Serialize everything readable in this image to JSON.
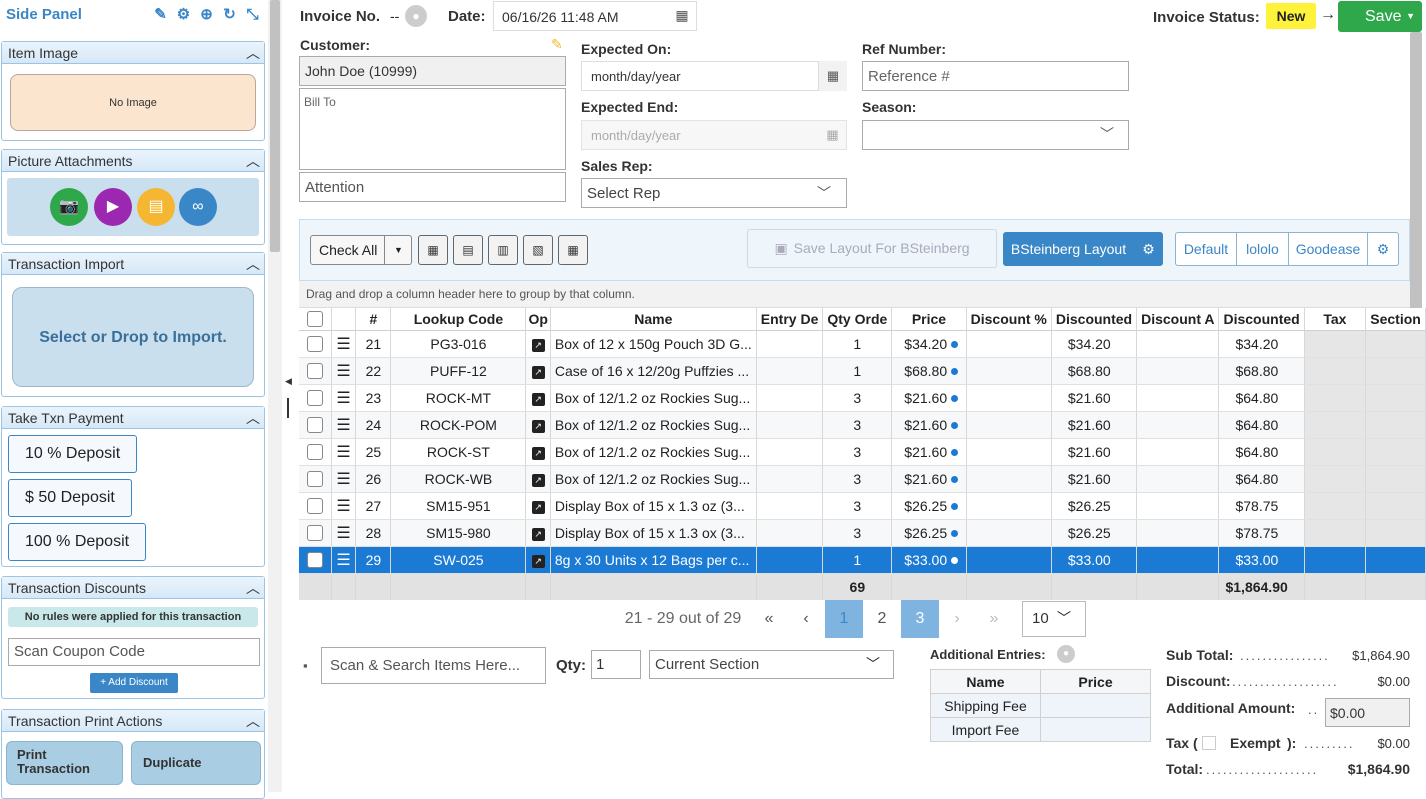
{
  "side_panel": {
    "title": "Side Panel",
    "icons": [
      "pencil-icon",
      "gear-icon",
      "plus-circle-icon",
      "refresh-icon",
      "collapse-icon"
    ],
    "item_image": {
      "header": "Item Image",
      "no_image": "No Image"
    },
    "picture_attachments": {
      "header": "Picture Attachments",
      "buttons": [
        {
          "icon": "camera-icon",
          "color": "#2ea84a"
        },
        {
          "icon": "video-icon",
          "color": "#9c27b0"
        },
        {
          "icon": "document-icon",
          "color": "#f5b731"
        },
        {
          "icon": "link-icon",
          "color": "#3a87c8"
        }
      ]
    },
    "transaction_import": {
      "header": "Transaction Import",
      "drop_text": "Select or Drop to Import."
    },
    "take_payment": {
      "header": "Take Txn Payment",
      "buttons": [
        "10 % Deposit",
        "$ 50 Deposit",
        "100 % Deposit"
      ]
    },
    "discounts": {
      "header": "Transaction Discounts",
      "notice": "No rules were applied for this transaction",
      "coupon_placeholder": "Scan Coupon Code",
      "add_button": "Add Discount"
    },
    "print_actions": {
      "header": "Transaction Print Actions",
      "buttons": [
        "Print Transaction",
        "Duplicate"
      ]
    }
  },
  "header": {
    "invoice_no_label": "Invoice No.",
    "invoice_no_value": "--",
    "date_label": "Date:",
    "date_value": "06/16/26 11:48 AM",
    "status_label": "Invoice Status:",
    "status_value": "New",
    "save_label": "Save"
  },
  "form": {
    "customer_label": "Customer:",
    "customer_value": "John Doe (10999)",
    "bill_to_placeholder": "Bill To",
    "attention_placeholder": "Attention",
    "expected_on_label": "Expected On:",
    "expected_on_placeholder": "month/day/year",
    "expected_end_label": "Expected End:",
    "expected_end_placeholder": "month/day/year",
    "sales_rep_label": "Sales Rep:",
    "sales_rep_value": "Select Rep",
    "ref_number_label": "Ref Number:",
    "ref_number_placeholder": "Reference #",
    "season_label": "Season:",
    "season_value": ""
  },
  "toolbar": {
    "check_all": "Check All",
    "save_layout": "Save Layout For BSteinberg",
    "active_layout": "BSteinberg Layout",
    "layouts": [
      "Default",
      "lololo",
      "Goodease"
    ],
    "group_hint": "Drag and drop a column header here to group by that column."
  },
  "grid": {
    "columns": [
      "#",
      "Lookup Code",
      "Op",
      "Name",
      "Entry De",
      "Qty Orde",
      "Price",
      "Discount %",
      "Discounted",
      "Discount A",
      "Discounted",
      "Tax",
      "Section"
    ],
    "rows": [
      {
        "num": "21",
        "code": "PG3-016",
        "name": "Box of 12 x 150g Pouch 3D G...",
        "qty": "1",
        "price": "$34.20",
        "disc_price": "$34.20",
        "ext": "$34.20",
        "selected": false
      },
      {
        "num": "22",
        "code": "PUFF-12",
        "name": "Case of 16 x 12/20g Puffzies ...",
        "qty": "1",
        "price": "$68.80",
        "disc_price": "$68.80",
        "ext": "$68.80",
        "selected": false
      },
      {
        "num": "23",
        "code": "ROCK-MT",
        "name": "Box of 12/1.2 oz Rockies Sug...",
        "qty": "3",
        "price": "$21.60",
        "disc_price": "$21.60",
        "ext": "$64.80",
        "selected": false
      },
      {
        "num": "24",
        "code": "ROCK-POM",
        "name": "Box of 12/1.2 oz Rockies Sug...",
        "qty": "3",
        "price": "$21.60",
        "disc_price": "$21.60",
        "ext": "$64.80",
        "selected": false
      },
      {
        "num": "25",
        "code": "ROCK-ST",
        "name": "Box of 12/1.2 oz Rockies Sug...",
        "qty": "3",
        "price": "$21.60",
        "disc_price": "$21.60",
        "ext": "$64.80",
        "selected": false
      },
      {
        "num": "26",
        "code": "ROCK-WB",
        "name": "Box of 12/1.2 oz Rockies Sug...",
        "qty": "3",
        "price": "$21.60",
        "disc_price": "$21.60",
        "ext": "$64.80",
        "selected": false
      },
      {
        "num": "27",
        "code": "SM15-951",
        "name": "Display Box of 15 x 1.3 oz (3...",
        "qty": "3",
        "price": "$26.25",
        "disc_price": "$26.25",
        "ext": "$78.75",
        "selected": false
      },
      {
        "num": "28",
        "code": "SM15-980",
        "name": "Display Box of 15 x 1.3 ox (3...",
        "qty": "3",
        "price": "$26.25",
        "disc_price": "$26.25",
        "ext": "$78.75",
        "selected": false
      },
      {
        "num": "29",
        "code": "SW-025",
        "name": "8g x 30 Units x 12 Bags per c...",
        "qty": "1",
        "price": "$33.00",
        "disc_price": "$33.00",
        "ext": "$33.00",
        "selected": true
      }
    ],
    "footer_qty": "69",
    "footer_total": "$1,864.90"
  },
  "pager": {
    "range": "21 - 29 out of 29",
    "pages": [
      "1",
      "2",
      "3"
    ],
    "current": "3",
    "page_size": "10"
  },
  "entry": {
    "search_placeholder": "Scan & Search Items Here...",
    "qty_label": "Qty:",
    "qty_value": "1",
    "section_value": "Current Section"
  },
  "additional": {
    "label": "Additional Entries:",
    "headers": [
      "Name",
      "Price"
    ],
    "rows": [
      "Shipping Fee",
      "Import Fee"
    ]
  },
  "summary": {
    "subtotal_label": "Sub Total:",
    "subtotal_value": "$1,864.90",
    "discount_label": "Discount:",
    "discount_value": "$0.00",
    "additional_label": "Additional Amount:",
    "additional_value": "$0.00",
    "tax_label": "Tax (",
    "exempt_label": "Exempt",
    "tax_close": "):",
    "tax_value": "$0.00",
    "total_label": "Total:",
    "total_value": "$1,864.90"
  },
  "colors": {
    "accent": "#1b7bd4",
    "save_green": "#2ea84a",
    "status_yellow": "#fff23a"
  }
}
